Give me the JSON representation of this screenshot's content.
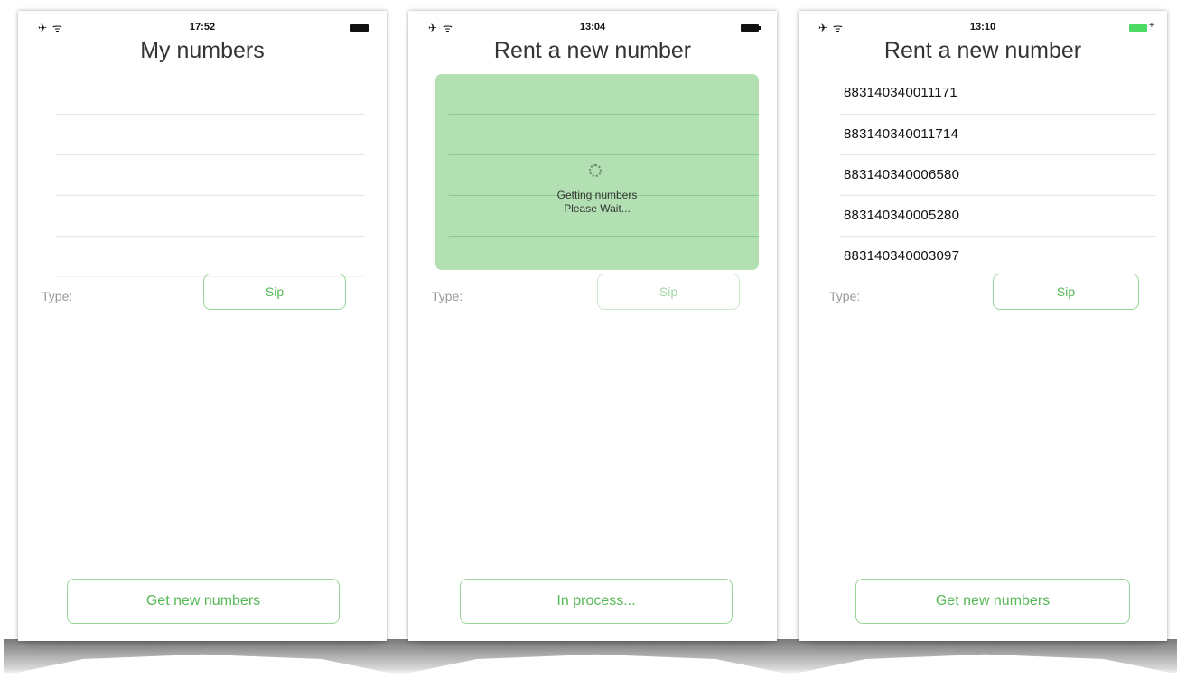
{
  "screens": [
    {
      "status": {
        "time": "17:52"
      },
      "title": "My numbers",
      "numbers": [],
      "type_label": "Type:",
      "type_value": "Sip",
      "main_button": "Get new numbers"
    },
    {
      "status": {
        "time": "13:04"
      },
      "title": "Rent a new number",
      "loading": {
        "line1": "Getting numbers",
        "line2": "Please Wait..."
      },
      "type_label": "Type:",
      "type_value": "Sip",
      "main_button": "In process..."
    },
    {
      "status": {
        "time": "13:10"
      },
      "title": "Rent a new number",
      "numbers": [
        "883140340011171",
        "883140340011714",
        "883140340006580",
        "883140340005280",
        "883140340003097"
      ],
      "type_label": "Type:",
      "type_value": "Sip",
      "main_button": "Get new numbers"
    }
  ],
  "colors": {
    "accent": "#55b855",
    "border": "#9ad59a",
    "overlay": "#82cd82",
    "battery_charging": "#4cd964"
  },
  "icons": {
    "airplane": "airplane-icon",
    "wifi": "wifi-icon",
    "battery": "battery-icon",
    "spinner": "spinner-icon"
  }
}
